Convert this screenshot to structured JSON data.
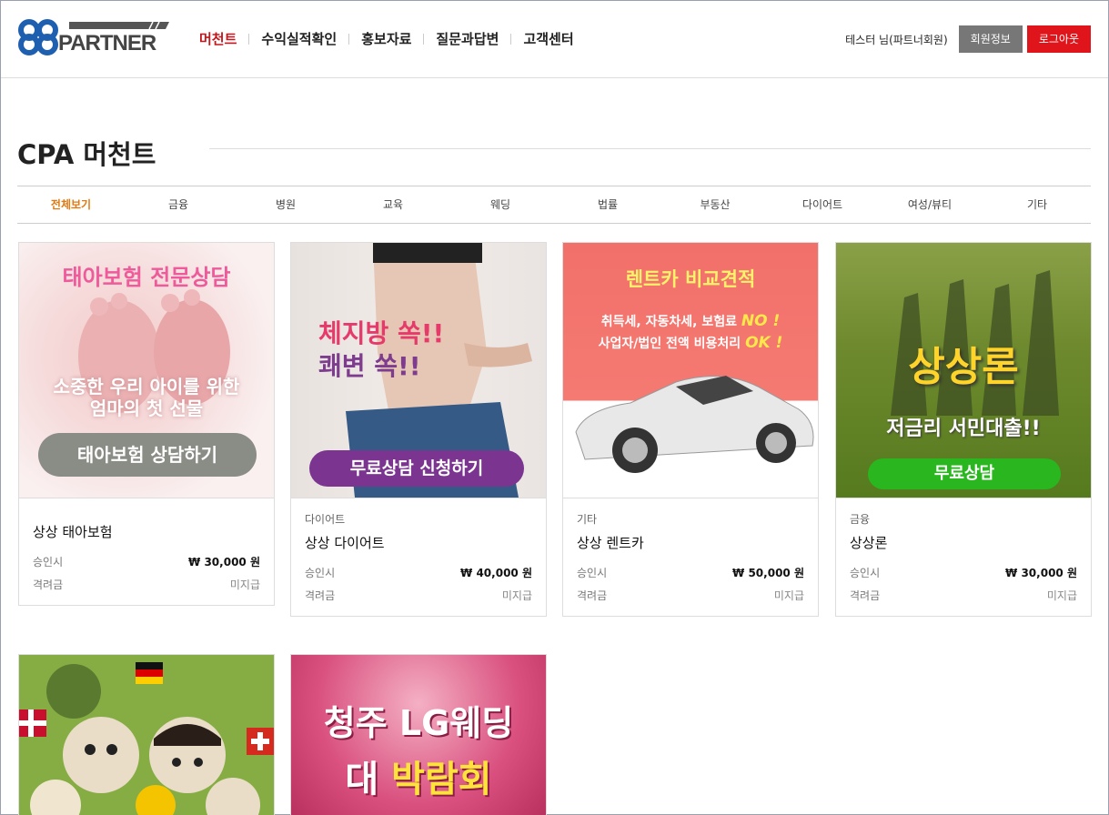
{
  "header": {
    "nav": [
      "머천트",
      "수익실적확인",
      "홍보자료",
      "질문과답변",
      "고객센터"
    ],
    "user_label": "테스터 님(파트너회원)",
    "member_info": "회원정보",
    "logout": "로그아웃",
    "logo_text": "PARTNER"
  },
  "page": {
    "title": "CPA 머천트",
    "tabs": [
      "전체보기",
      "금융",
      "병원",
      "교육",
      "웨딩",
      "법률",
      "부동산",
      "다이어트",
      "여성/뷰티",
      "기타"
    ]
  },
  "labels": {
    "approve": "승인시",
    "bonus": "격려금"
  },
  "cards": [
    {
      "category": "",
      "name": "상상 태아보험",
      "approve_amount": "₩ 30,000 원",
      "bonus": "미지급",
      "banner": {
        "headline": "태아보험 전문상담",
        "sub1": "소중한 우리 아이를 위한",
        "sub2": "엄마의 첫 선물",
        "button": "태아보험 상담하기"
      }
    },
    {
      "category": "다이어트",
      "name": "상상 다이어트",
      "approve_amount": "₩ 40,000 원",
      "bonus": "미지급",
      "banner": {
        "line1": "체지방 쏙!!",
        "line2": "쾌변 쏙!!",
        "button": "무료상담 신청하기"
      }
    },
    {
      "category": "기타",
      "name": "상상 렌트카",
      "approve_amount": "₩ 50,000 원",
      "bonus": "미지급",
      "banner": {
        "headline": "렌트카 비교견적",
        "sub1": "취득세, 자동차세, 보험료",
        "sub1_tag": "NO !",
        "sub2": "사업자/법인 전액 비용처리",
        "sub2_tag": "OK !"
      }
    },
    {
      "category": "금융",
      "name": "상상론",
      "approve_amount": "₩ 30,000 원",
      "bonus": "미지급",
      "banner": {
        "headline": "상상론",
        "sub": "저금리 서민대출!!",
        "button": "무료상담"
      }
    },
    {
      "category": "",
      "name": "",
      "banner": {}
    },
    {
      "category": "",
      "name": "",
      "banner": {
        "line1": "청주 LG웨딩",
        "line2a": "대",
        "line2b": "박람회"
      }
    }
  ]
}
